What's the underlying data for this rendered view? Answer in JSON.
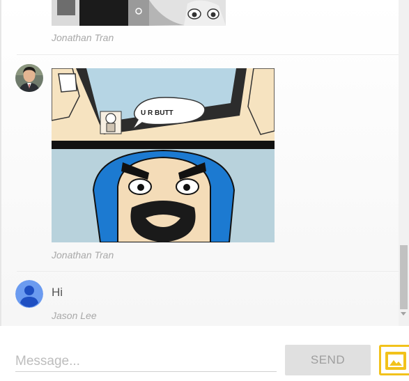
{
  "messages": [
    {
      "author": "Jonathan Tran",
      "type": "image",
      "image": "manga-panel"
    },
    {
      "author": "Jonathan Tran",
      "type": "image",
      "image": "comic-phone-wizard",
      "image_text": "U R BUTT"
    },
    {
      "author": "Jason Lee",
      "type": "text",
      "text": "Hi"
    }
  ],
  "composer": {
    "placeholder": "Message...",
    "value": "",
    "send_label": "SEND",
    "image_icon": "image-icon"
  },
  "colors": {
    "accent": "#f2c21b",
    "send_bg": "#e0e0e0",
    "author": "#a8a8a8",
    "avatar_default": "#6b9bf0"
  }
}
